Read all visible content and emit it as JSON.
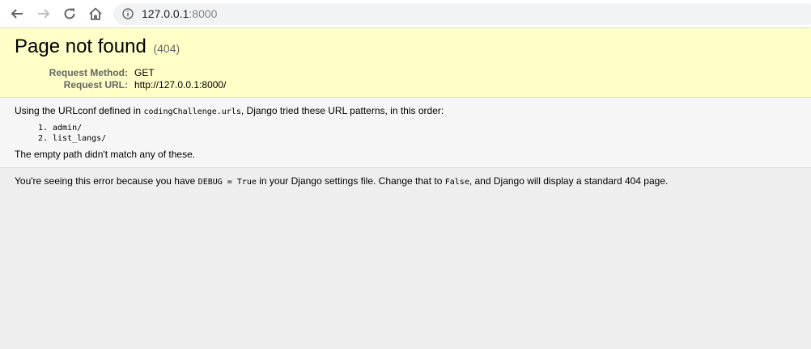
{
  "browser": {
    "url_host": "127.0.0.1",
    "url_port": ":8000"
  },
  "summary": {
    "title": "Page not found",
    "status_code": "(404)",
    "request_method_label": "Request Method:",
    "request_method_value": "GET",
    "request_url_label": "Request URL:",
    "request_url_value": "http://127.0.0.1:8000/"
  },
  "info": {
    "intro_before": "Using the URLconf defined in ",
    "urlconf_module": "codingChallenge.urls",
    "intro_after": ", Django tried these URL patterns, in this order:",
    "patterns": [
      "admin/",
      "list_langs/"
    ],
    "no_match": "The empty path didn't match any of these."
  },
  "explanation": {
    "part1": "You're seeing this error because you have ",
    "debug_code": "DEBUG = True",
    "part2": " in your Django settings file. Change that to ",
    "false_code": "False",
    "part3": ", and Django will display a standard 404 page."
  },
  "colors": {
    "summary_bg": "#ffffc8",
    "info_bg": "#f6f6f6",
    "page_bg": "#eeeeee"
  }
}
